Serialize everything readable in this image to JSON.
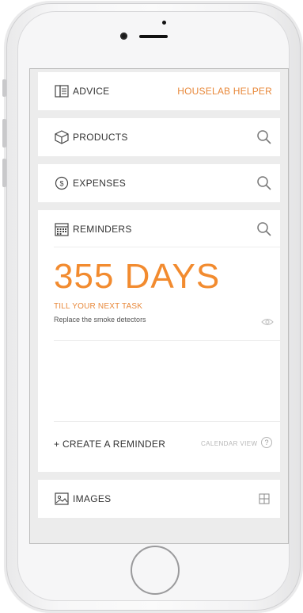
{
  "advice": {
    "title": "ADVICE",
    "link": "HOUSELAB HELPER"
  },
  "products": {
    "title": "PRODUCTS"
  },
  "expenses": {
    "title": "EXPENSES"
  },
  "reminders": {
    "title": "REMINDERS",
    "days": "355 DAYS",
    "subtitle": "TILL YOUR NEXT TASK",
    "task": "Replace the smoke detectors",
    "create": "+ CREATE A REMINDER",
    "calendar": "CALENDAR VIEW",
    "help": "?"
  },
  "images": {
    "title": "IMAGES"
  },
  "colors": {
    "accent": "#e8883a",
    "background": "#ececec"
  },
  "icons": [
    "book-icon",
    "box-icon",
    "coin-icon",
    "calendar-icon",
    "image-icon",
    "search-icon",
    "eye-icon",
    "grid-icon",
    "help-icon"
  ]
}
